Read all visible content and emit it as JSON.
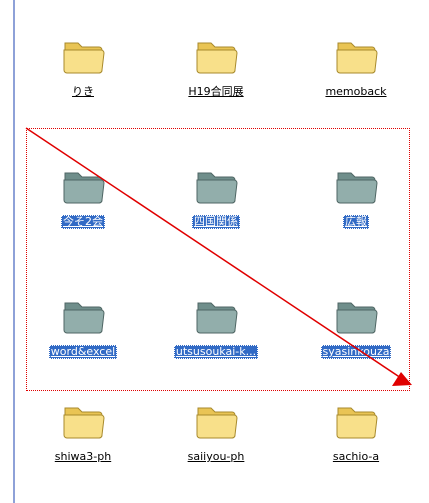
{
  "folders": [
    {
      "label": "りき",
      "selected": false
    },
    {
      "label": "H19合同展",
      "selected": false
    },
    {
      "label": "memoback",
      "selected": false
    },
    {
      "label": "今そ2会",
      "selected": true
    },
    {
      "label": "四国関係",
      "selected": true
    },
    {
      "label": "広報",
      "selected": true
    },
    {
      "label": "word&excel",
      "selected": true
    },
    {
      "label": "utsusoukai-k...",
      "selected": true
    },
    {
      "label": "syasinkouza",
      "selected": true
    },
    {
      "label": "shiwa3-ph",
      "selected": false
    },
    {
      "label": "saiiyou-ph",
      "selected": false
    },
    {
      "label": "sachio-a",
      "selected": false
    }
  ],
  "colors": {
    "folder_normal": "#f3d46a",
    "folder_selected": "#8ea9a6",
    "selection_bg": "#316ac5",
    "marquee": "#e00000"
  },
  "icons": {
    "folder": "folder-icon"
  }
}
